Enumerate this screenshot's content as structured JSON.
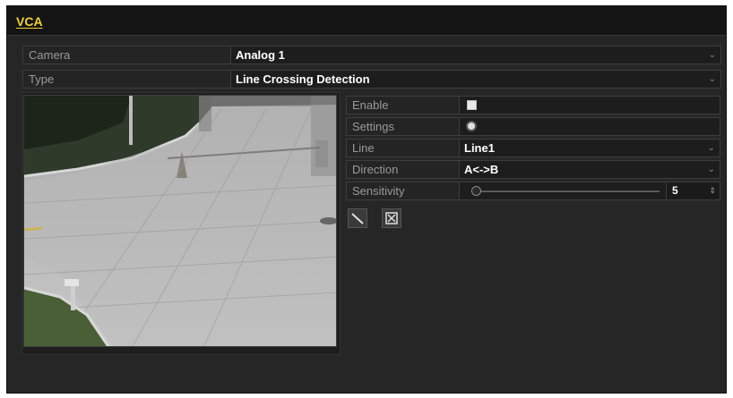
{
  "window": {
    "tab_title": "VCA"
  },
  "camera": {
    "label": "Camera",
    "value": "Analog 1"
  },
  "type": {
    "label": "Type",
    "value": "Line Crossing Detection"
  },
  "settings_panel": {
    "enable_label": "Enable",
    "enable_checked": false,
    "settings_label": "Settings",
    "line_label": "Line",
    "line_value": "Line1",
    "direction_label": "Direction",
    "direction_value": "A<->B",
    "sensitivity_label": "Sensitivity",
    "sensitivity_value": "5",
    "sensitivity_level_fraction": 0.0
  },
  "toolbar": {
    "draw_line_icon": "draw-line-icon",
    "clear_icon": "clear-icon"
  },
  "colors": {
    "accent_title": "#f2d233",
    "panel_bg": "#262626",
    "field_bg": "#1d1d1d"
  }
}
